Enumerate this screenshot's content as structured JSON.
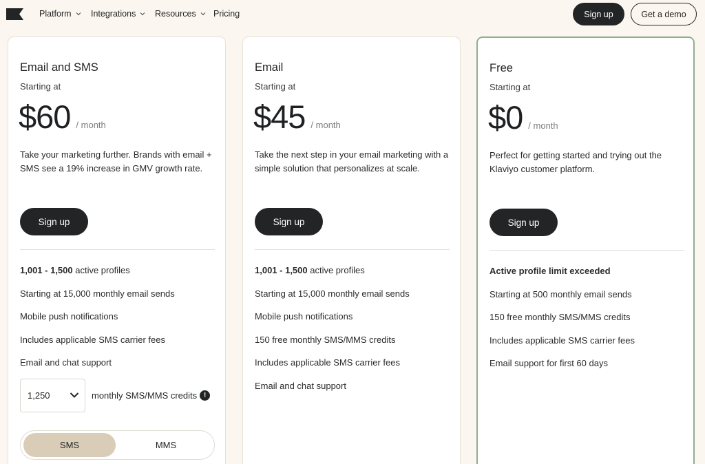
{
  "nav": {
    "logo_icon": "klaviyo-flag-logo",
    "items": [
      {
        "label": "Platform",
        "has_dropdown": true
      },
      {
        "label": "Integrations",
        "has_dropdown": true
      },
      {
        "label": "Resources",
        "has_dropdown": true
      },
      {
        "label": "Pricing",
        "has_dropdown": false
      }
    ],
    "signup_label": "Sign up",
    "demo_label": "Get a demo"
  },
  "colors": {
    "background": "#fbf6ef",
    "dark_button": "#232426",
    "featured_border": "#8fb08f",
    "toggle_active": "#d9cdb8"
  },
  "plans": [
    {
      "name": "Email and SMS",
      "starting_label": "Starting at",
      "price": "$60",
      "per": "/ month",
      "description": "Take your marketing further. Brands with email + SMS see a 19% increase in GMV growth rate.",
      "signup_label": "Sign up",
      "features": [
        {
          "bold": "1,001 - 1,500",
          "text": " active profiles"
        },
        {
          "bold": "",
          "text": "Starting at 15,000 monthly email sends"
        },
        {
          "bold": "",
          "text": "Mobile push notifications"
        },
        {
          "bold": "",
          "text": "Includes applicable SMS carrier fees"
        },
        {
          "bold": "",
          "text": "Email and chat support"
        }
      ],
      "sms_credits": {
        "selected": "1,250",
        "label": "monthly SMS/MMS credits",
        "info_icon": "!"
      },
      "toggle": {
        "active": "SMS",
        "inactive": "MMS"
      }
    },
    {
      "name": "Email",
      "starting_label": "Starting at",
      "price": "$45",
      "per": "/ month",
      "description": "Take the next step in your email marketing with a simple solution that personalizes at scale.",
      "signup_label": "Sign up",
      "features": [
        {
          "bold": "1,001 - 1,500",
          "text": " active profiles"
        },
        {
          "bold": "",
          "text": "Starting at 15,000 monthly email sends"
        },
        {
          "bold": "",
          "text": "Mobile push notifications"
        },
        {
          "bold": "",
          "text": "150 free monthly SMS/MMS credits"
        },
        {
          "bold": "",
          "text": "Includes applicable SMS carrier fees"
        },
        {
          "bold": "",
          "text": "Email and chat support"
        }
      ]
    },
    {
      "name": "Free",
      "starting_label": "Starting at",
      "price": "$0",
      "per": "/ month",
      "description": "Perfect for getting started and trying out the Klaviyo customer platform.",
      "signup_label": "Sign up",
      "features": [
        {
          "bold": "Active profile limit exceeded",
          "text": ""
        },
        {
          "bold": "",
          "text": "Starting at 500 monthly email sends"
        },
        {
          "bold": "",
          "text": "150 free monthly SMS/MMS credits"
        },
        {
          "bold": "",
          "text": "Includes applicable SMS carrier fees"
        },
        {
          "bold": "",
          "text": "Email support for first 60 days"
        }
      ]
    }
  ]
}
